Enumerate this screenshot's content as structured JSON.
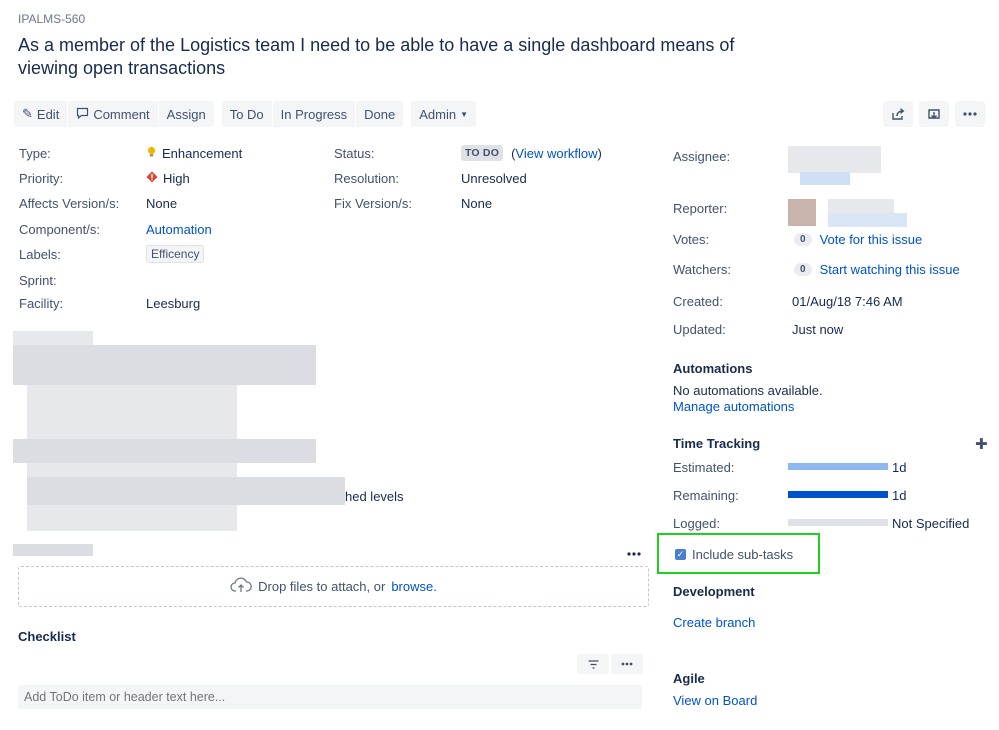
{
  "issue": {
    "key": "IPALMS-560",
    "title": "As a member of the Logistics team I need to be able to have a single dashboard means of viewing open transactions"
  },
  "toolbar": {
    "edit_label": "Edit",
    "comment_label": "Comment",
    "assign_label": "Assign",
    "todo_label": "To Do",
    "in_progress_label": "In Progress",
    "done_label": "Done",
    "admin_label": "Admin",
    "share_icon": "share-icon",
    "export_icon": "export-icon",
    "more_icon": "more-icon"
  },
  "details": {
    "type_label": "Type:",
    "type_value": "Enhancement",
    "priority_label": "Priority:",
    "priority_value": "High",
    "affects_label": "Affects Version/s:",
    "affects_value": "None",
    "components_label": "Component/s:",
    "components_value": "Automation",
    "labels_label": "Labels:",
    "labels_value": "Efficency",
    "sprint_label": "Sprint:",
    "facility_label": "Facility:",
    "facility_value": "Leesburg",
    "status_label": "Status:",
    "status_value": "TO DO",
    "view_workflow_prefix": "(",
    "view_workflow": "View workflow",
    "view_workflow_suffix": ")",
    "resolution_label": "Resolution:",
    "resolution_value": "Unresolved",
    "fix_label": "Fix Version/s:",
    "fix_value": "None"
  },
  "description": {
    "visible_fragment": "hed levels"
  },
  "attachments": {
    "drop_text": "Drop files to attach, or",
    "browse_link": "browse."
  },
  "checklist": {
    "heading": "Checklist",
    "placeholder": "Add ToDo item or header text here..."
  },
  "people": {
    "assignee_label": "Assignee:",
    "reporter_label": "Reporter:",
    "votes_label": "Votes:",
    "votes_count": "0",
    "vote_link": "Vote for this issue",
    "watchers_label": "Watchers:",
    "watchers_count": "0",
    "watch_link": "Start watching this issue"
  },
  "dates": {
    "created_label": "Created:",
    "created_value": "01/Aug/18 7:46 AM",
    "updated_label": "Updated:",
    "updated_value": "Just now"
  },
  "automations": {
    "heading": "Automations",
    "none_text": "No automations available.",
    "manage_link": "Manage automations"
  },
  "time_tracking": {
    "heading": "Time Tracking",
    "add_icon": "plus-icon",
    "estimated_label": "Estimated:",
    "estimated_value": "1d",
    "estimated_fill": 1.0,
    "remaining_label": "Remaining:",
    "remaining_value": "1d",
    "remaining_fill": 1.0,
    "logged_label": "Logged:",
    "logged_value": "Not Specified",
    "logged_fill": 0.0,
    "include_subtasks": "Include sub-tasks",
    "include_subtasks_checked": true,
    "colors": {
      "estimated": "#8fb8f0",
      "remaining": "#0052cc",
      "empty": "#dfe1e6",
      "highlight": "#1fd11f"
    }
  },
  "development": {
    "heading": "Development",
    "create_branch": "Create branch"
  },
  "agile": {
    "heading": "Agile",
    "view_on_board": "View on Board"
  }
}
